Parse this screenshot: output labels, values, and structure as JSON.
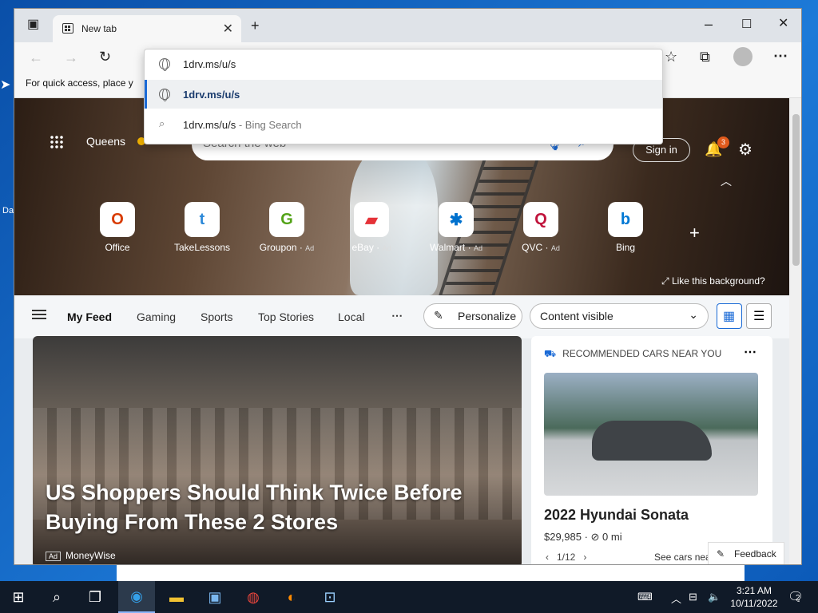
{
  "browser": {
    "tab_title": "New tab",
    "address_value": "1drv.ms/u/s",
    "favbar_text": "For quick access, place y",
    "suggestions": [
      {
        "text": "1drv.ms/u/s",
        "hint": ""
      },
      {
        "text": "1drv.ms/u/s",
        "hint": " - Bing Search"
      }
    ]
  },
  "desktop": {
    "frag1": "Da"
  },
  "hero": {
    "location": "Queens",
    "weather": "Sunris...",
    "search_placeholder": "Search the web",
    "signin": "Sign in",
    "notif_count": "3",
    "tiles": [
      {
        "label": "Office",
        "ad": "",
        "glyph": "O",
        "color": "#d83b01"
      },
      {
        "label": "TakeLessons",
        "ad": "",
        "glyph": "t",
        "color": "#2b88d8"
      },
      {
        "label": "Groupon",
        "ad": "Ad",
        "glyph": "G",
        "color": "#53a318"
      },
      {
        "label": "eBay",
        "ad": "Ad",
        "glyph": "▰",
        "color": "#e53238"
      },
      {
        "label": "Walmart",
        "ad": "Ad",
        "glyph": "✱",
        "color": "#0071ce"
      },
      {
        "label": "QVC",
        "ad": "Ad",
        "glyph": "Q",
        "color": "#c0143c"
      },
      {
        "label": "Bing",
        "ad": "",
        "glyph": "b",
        "color": "#0078d4"
      }
    ],
    "like_bg": "Like this background?"
  },
  "feed": {
    "nav": [
      "My Feed",
      "Gaming",
      "Sports",
      "Top Stories",
      "Local"
    ],
    "personalize": "Personalize",
    "content_visible": "Content visible",
    "main_title": "US Shoppers Should Think Twice Before Buying From These 2 Stores",
    "main_ad": "Ad",
    "main_source": "MoneyWise",
    "car_header": "RECOMMENDED CARS NEAR YOU",
    "car_name": "2022 Hyundai Sonata",
    "car_price": "$29,985 · ⊘ 0 mi",
    "car_pager": "1/12",
    "car_more": "See cars nea",
    "feedback": "Feedback"
  },
  "taskbar": {
    "time": "3:21 AM",
    "date": "10/11/2022",
    "notif_count": "2"
  }
}
